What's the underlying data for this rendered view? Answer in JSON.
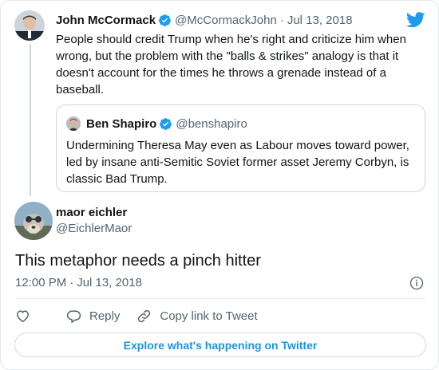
{
  "parent_tweet": {
    "author_name": "John McCormack",
    "author_handle": "@McCormackJohn",
    "separator": "·",
    "date": "Jul 13, 2018",
    "text": "People should credit Trump when he's right and criticize him when wrong, but the problem with the \"balls & strikes\" analogy is that it doesn't account for the times he throws a grenade instead of a baseball."
  },
  "quoted_tweet": {
    "author_name": "Ben Shapiro",
    "author_handle": "@benshapiro",
    "text": "Undermining Theresa May even as Labour moves toward power, led by insane anti-Semitic Soviet former asset Jeremy Corbyn, is classic Bad Trump."
  },
  "main_tweet": {
    "author_name": "maor eichler",
    "author_handle": "@EichlerMaor",
    "text": "This metaphor needs a pinch hitter",
    "time": "12:00 PM",
    "separator": "·",
    "date": "Jul 13, 2018"
  },
  "actions": {
    "reply_label": "Reply",
    "copy_link_label": "Copy link to Tweet"
  },
  "explore_label": "Explore what's happening on Twitter",
  "colors": {
    "brand_blue": "#1d9bf0",
    "link_blue": "#1b95e0",
    "secondary_text": "#536471",
    "border": "#e1e8ed"
  },
  "icons": {
    "logo": "twitter-bird-icon",
    "verified": "verified-badge-icon",
    "info": "info-icon",
    "like": "heart-icon",
    "reply": "speech-bubble-icon",
    "copy_link": "link-icon"
  }
}
